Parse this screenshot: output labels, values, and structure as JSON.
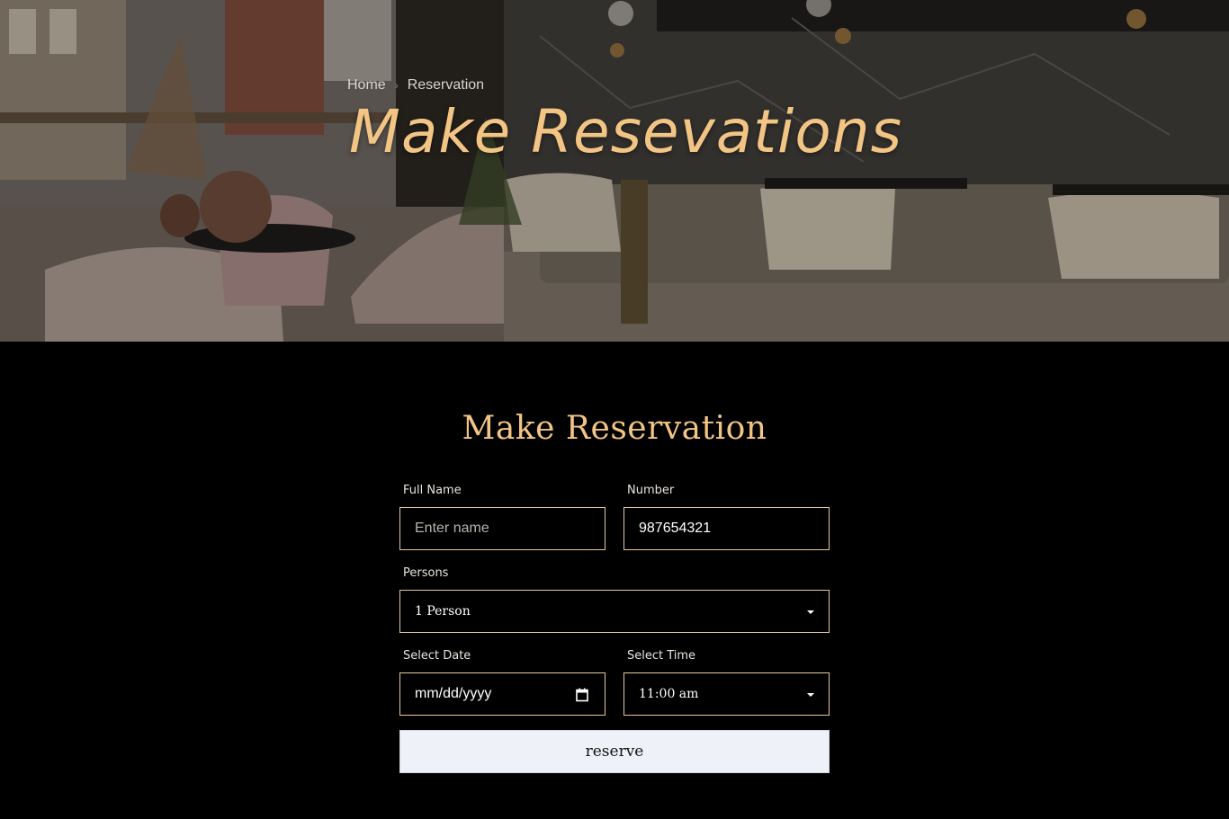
{
  "breadcrumb": {
    "home": "Home",
    "current": "Reservation"
  },
  "hero": {
    "title": "Make Resevations"
  },
  "form": {
    "title": "Make Reservation",
    "full_name": {
      "label": "Full Name",
      "placeholder": "Enter name"
    },
    "number": {
      "label": "Number",
      "value": "987654321"
    },
    "persons": {
      "label": "Persons",
      "value": "1 Person"
    },
    "date": {
      "label": "Select Date",
      "placeholder": "mm/dd/yyyy"
    },
    "time": {
      "label": "Select Time",
      "value": "11:00 am"
    },
    "submit": "reserve"
  },
  "colors": {
    "accent": "#f3c585",
    "field_border": "#e7c89c",
    "button_bg": "#eef2f8"
  },
  "icons": [
    "chevron-right-icon",
    "dropdown-caret-icon",
    "calendar-icon"
  ]
}
